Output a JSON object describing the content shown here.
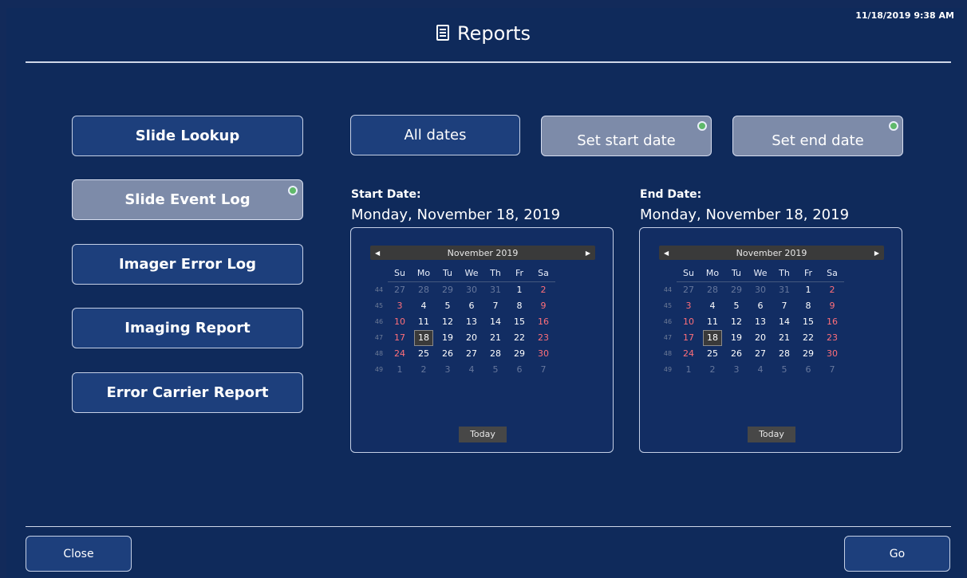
{
  "header": {
    "title": "Reports",
    "datetime": "11/18/2019 9:38 AM",
    "icon": "document-icon"
  },
  "sidebar": {
    "items": [
      {
        "label": "Slide Lookup",
        "active": false
      },
      {
        "label": "Slide Event Log",
        "active": true
      },
      {
        "label": "Imager Error Log",
        "active": false
      },
      {
        "label": "Imaging Report",
        "active": false
      },
      {
        "label": "Error Carrier Report",
        "active": false
      }
    ]
  },
  "date_filter": {
    "all_dates": "All dates",
    "set_start": "Set start date",
    "set_end": "Set end date"
  },
  "start": {
    "caption": "Start Date:",
    "full_date": "Monday, November 18, 2019",
    "month": "November 2019",
    "today": "Today"
  },
  "end": {
    "caption": "End Date:",
    "full_date": "Monday, November 18, 2019",
    "month": "November 2019",
    "today": "Today"
  },
  "calendar": {
    "dow": [
      "Su",
      "Mo",
      "Tu",
      "We",
      "Th",
      "Fr",
      "Sa"
    ],
    "weeks": [
      {
        "wk": "44",
        "days": [
          "27",
          "28",
          "29",
          "30",
          "31",
          "1",
          "2"
        ]
      },
      {
        "wk": "45",
        "days": [
          "3",
          "4",
          "5",
          "6",
          "7",
          "8",
          "9"
        ]
      },
      {
        "wk": "46",
        "days": [
          "10",
          "11",
          "12",
          "13",
          "14",
          "15",
          "16"
        ]
      },
      {
        "wk": "47",
        "days": [
          "17",
          "18",
          "19",
          "20",
          "21",
          "22",
          "23"
        ]
      },
      {
        "wk": "48",
        "days": [
          "24",
          "25",
          "26",
          "27",
          "28",
          "29",
          "30"
        ]
      },
      {
        "wk": "49",
        "days": [
          "1",
          "2",
          "3",
          "4",
          "5",
          "6",
          "7"
        ]
      }
    ],
    "selected": "18"
  },
  "footer": {
    "close": "Close",
    "go": "Go"
  },
  "colors": {
    "background": "#0f2a5b",
    "button": "#1d3f7c",
    "active_button": "#7d8ba9",
    "weekend": "#ff6f7a",
    "indicator": "#5fb96a"
  }
}
